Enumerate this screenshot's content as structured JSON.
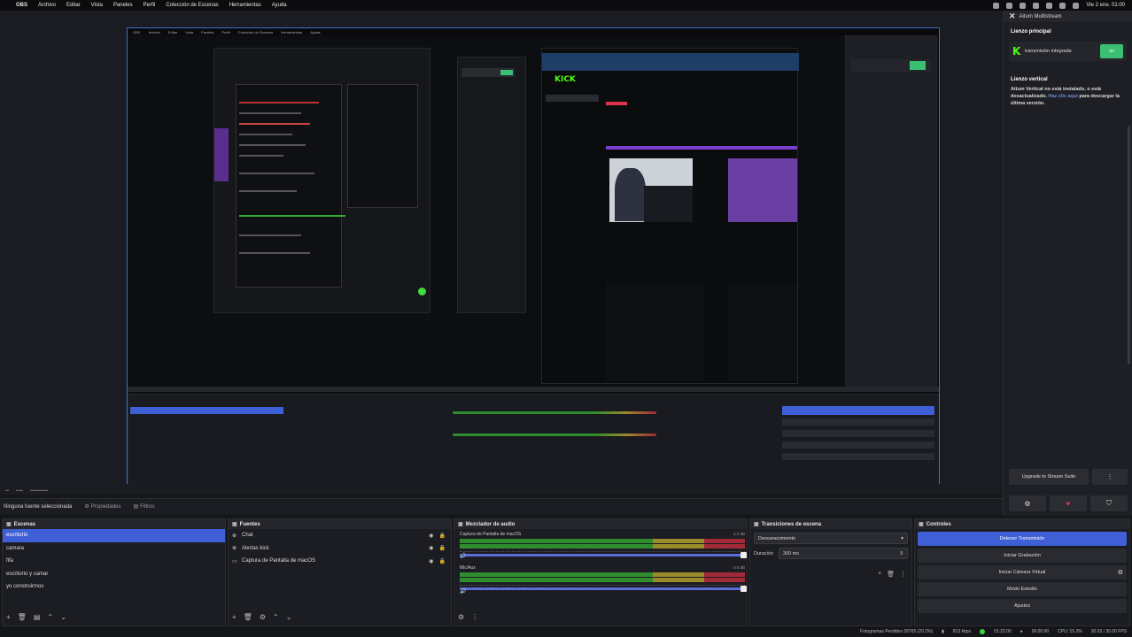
{
  "menubar": {
    "app": "OBS",
    "items": [
      "Archivo",
      "Editar",
      "Vista",
      "Paneles",
      "Perfil",
      "Colección de Escenas",
      "Herramientas",
      "Ayuda"
    ],
    "clock": "Vie 2 ene. 01:00"
  },
  "toolbar": {
    "no_source": "Ninguna fuente seleccionada",
    "properties": "Propiedades",
    "filters": "Filtros"
  },
  "scenes": {
    "title": "Escenas",
    "items": [
      "escritorio",
      "camara",
      "fifa",
      "escritorio y camar",
      "yo construirmos"
    ],
    "selected_index": 0
  },
  "sources": {
    "title": "Fuentes",
    "items": [
      "Chat",
      "Alertas kick",
      "Captura de Pantalla de macOS"
    ]
  },
  "mixer": {
    "title": "Mezclador de audio",
    "channels": [
      {
        "name": "Captura de Pantalla de macOS",
        "db": "0.0 dB"
      },
      {
        "name": "Mic/Aux",
        "db": "0.0 dB"
      }
    ]
  },
  "transitions": {
    "title": "Transiciones de escena",
    "type": "Desvanecimiento",
    "duration_label": "Duración",
    "duration_value": "300 ms"
  },
  "controls": {
    "title": "Controles",
    "stop_stream": "Detener Transmisión",
    "start_recording": "Iniciar Grabación",
    "start_virtual_cam": "Iniciar Cámara Virtual",
    "studio_mode": "Modo Estudio",
    "settings": "Ajustes"
  },
  "aitum": {
    "title": "Aitum Multistream",
    "main_canvas": "Lienzo principal",
    "stream_label": "transmisión integrada",
    "stream_button": "on",
    "vertical_canvas": "Lienzo vertical",
    "notice_line1": "Aitum Vertical no está instalado, o está desactualizado.",
    "notice_link": "Haz clic aquí",
    "notice_line2": "para descargar la última versión.",
    "upgrade": "Upgrade to Stream Suite",
    "more": "⋮",
    "icons": [
      "gear-icon",
      "heart-icon",
      "shield-icon"
    ]
  },
  "statusbar": {
    "dropped": "Fotogramas Perdidos 28765 (20.2%)",
    "kbps": "813 kbps",
    "live_time": "01:22:00",
    "rec_time": "00:00:00",
    "cpu": "CPU: 15.3%",
    "fps": "30.03 / 30.00 FPS"
  },
  "colors": {
    "accent": "#3f5fd6",
    "kick_green": "#53fc18",
    "live_red": "#e0344d"
  }
}
